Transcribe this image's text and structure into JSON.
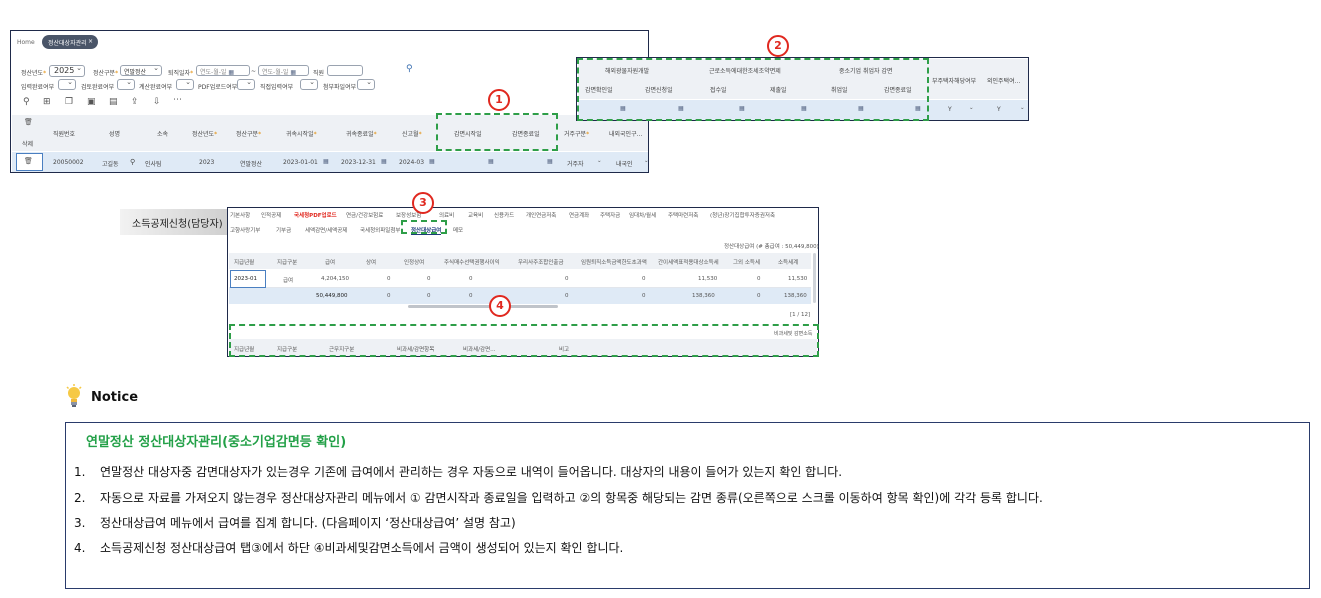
{
  "panel1": {
    "tabs": {
      "home": "Home",
      "active": "정산대상자관리",
      "close": "×"
    },
    "filters": {
      "year_label": "정산년도",
      "year_value": "2025",
      "type_label": "정산구분",
      "type_value": "연말정산",
      "date_label": "퇴직일자",
      "date_from": "연도-월-일",
      "date_tilde": "~",
      "date_to": "연도-월-일",
      "staff_label": "직원",
      "r2_1": "입력완료여부",
      "r2_2": "검토완료여부",
      "r2_3": "계산완료여부",
      "r2_4": "PDF업로드여부",
      "r2_5": "직접입력여부",
      "r2_6": "첨부파일여부"
    },
    "columns": [
      "직원번호",
      "성명",
      "소속",
      "정산년도",
      "정산구분",
      "귀속시작일",
      "귀속종료일",
      "신고월",
      "감면시작일",
      "감면종료일",
      "거주구분",
      "내외국인구…"
    ],
    "delete_label": "삭제",
    "row": {
      "emp_no": "20050002",
      "name": "고길동",
      "dept": "인사팀",
      "year": "2023",
      "type": "연말정산",
      "start": "2023-01-01",
      "end": "2023-12-31",
      "month": "2024-03",
      "residence": "거주자",
      "nationality": "내국인"
    }
  },
  "panel2": {
    "groups": [
      "해외광물자원개발",
      "근로소득에대한조세조약면제",
      "중소기업 취업자 감면"
    ],
    "subcols": [
      "감면확인일",
      "감면신청일",
      "접수일",
      "제출일",
      "취업일",
      "감면종료일"
    ],
    "extra_cols": [
      "부주택자해당여부",
      "외인주택여…"
    ],
    "row": {
      "y1": "Y",
      "y2": "Y"
    }
  },
  "panel3": {
    "side_label": "소득공제신청(담당자)",
    "tabs_row1": [
      "기본사항",
      "인적공제",
      "국세청PDF업로드",
      "연금/건강보험료",
      "보장성보험",
      "의료비",
      "교육비",
      "신용카드",
      "개인연금저축",
      "연금계좌",
      "주택자금",
      "임대차/월세",
      "주택마련저축",
      "(청년)장기집합투자증권저축"
    ],
    "tabs_row2": [
      "고향사랑기부",
      "기부금",
      "세액감면/세액공제",
      "국세청외파일첨부",
      "정산대상급여",
      "메모"
    ],
    "summary": "정산대상급여  (# 총급여 : 50,449,800)",
    "columns": [
      "지급년월",
      "지급구분",
      "급여",
      "상여",
      "인정상여",
      "주식매수선택권행사이익",
      "우리사주조합인출금",
      "임원퇴직소득금액한도초과액",
      "간이세액표적용대상소득세",
      "그외 소득세",
      "소득세계"
    ],
    "row": {
      "ym": "2023-01",
      "kind": "급여",
      "pay": "4,204,150",
      "bonus": "0",
      "recog": "0",
      "stock": "0",
      "esop": "0",
      "exec": "0",
      "simple": "11,530",
      "other": "0",
      "total": "11,530"
    },
    "totals": {
      "pay": "50,449,800",
      "bonus": "0",
      "recog": "0",
      "stock": "0",
      "esop": "0",
      "exec": "0",
      "simple": "138,360",
      "other": "0",
      "total": "138,360"
    },
    "pager": "[1 / 12]",
    "bottom_label": "비과세및 감면소득",
    "bottom_columns": [
      "지급년월",
      "지급구분",
      "근무지구분",
      "비과세/감면항목",
      "비과세/감면…",
      "비고"
    ]
  },
  "markers": [
    "1",
    "2",
    "3",
    "4"
  ],
  "notice": {
    "heading": "Notice",
    "title": "연말정산 정산대상자관리(중소기업감면등 확인)",
    "items": [
      {
        "num": "1.",
        "text": "연말정산 대상자중 감면대상자가 있는경우 기존에 급여에서 관리하는 경우 자동으로 내역이 들어옵니다. 대상자의 내용이 들어가 있는지 확인 합니다."
      },
      {
        "num": "2.",
        "text": "자동으로 자료를 가져오지 않는경우 정산대상자관리 메뉴에서 ① 감면시작과 종료일을 입력하고 ②의 항목중 해당되는 감면 종류(오른쪽으로 스크롤 이동하여 항목 확인)에 각각 등록 합니다."
      },
      {
        "num": "3.",
        "text": "정산대상급여 메뉴에서 급여를 집계 합니다. (다음페이지 ‘정산대상급여’ 설명 참고)"
      },
      {
        "num": "4.",
        "text": "소득공제신청 정산대상급여 탭③에서 하단 ④비과세및감면소득에서 금액이 생성되어 있는지 확인 합니다."
      }
    ]
  },
  "colors": {
    "accent_green": "#2e9e48",
    "marker_red": "#e0281f",
    "tab_red": "#e0281f",
    "navy": "#1f2a4a"
  }
}
